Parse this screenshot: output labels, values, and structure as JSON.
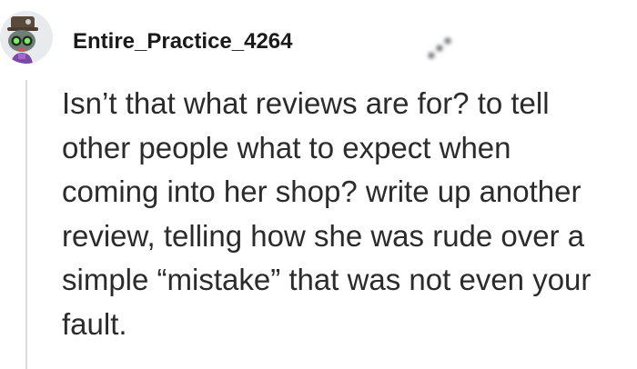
{
  "comment": {
    "author": "Entire_Practice_4264",
    "avatar_icon": "snoo-avatar-icon",
    "more_icon": "more-options-icon",
    "body": "Isn’t that what reviews are for? to tell\nother people what to expect when\ncoming into her shop? write up another\nreview, telling how she was rude over a\nsimple “mistake” that was not even your\nfault."
  }
}
